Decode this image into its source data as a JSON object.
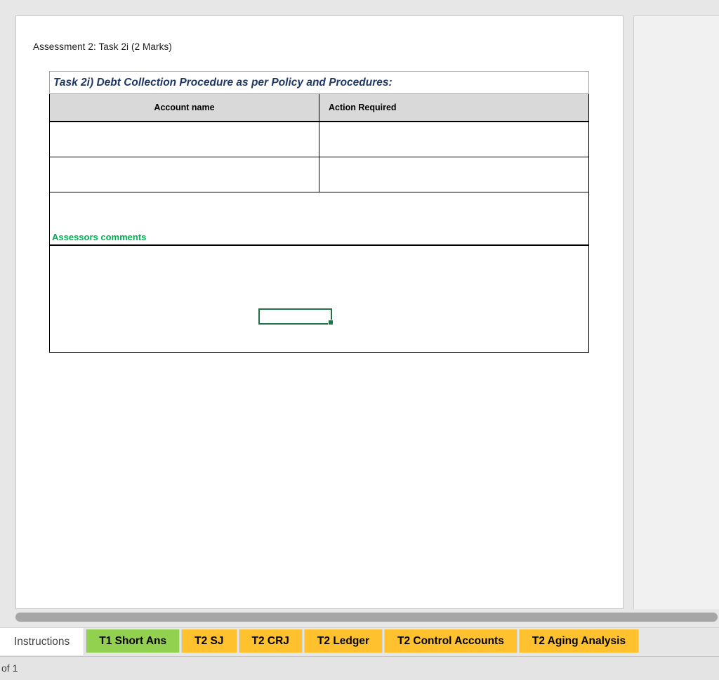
{
  "document": {
    "assessment_caption": "Assessment 2: Task 2i (2 Marks)",
    "table": {
      "title": "Task 2i) Debt Collection Procedure as per Policy and Procedures:",
      "columns": [
        "Account name",
        "Action Required"
      ],
      "rows": [
        {
          "account_name": "",
          "action_required": ""
        },
        {
          "account_name": "",
          "action_required": ""
        }
      ],
      "assessors_comments_label": "Assessors comments",
      "assessors_comments_value": ""
    }
  },
  "selection": {
    "active_cell_value": ""
  },
  "sheet_tabs": [
    {
      "label": "Instructions",
      "state": "active",
      "color": "#ffffff"
    },
    {
      "label": "T1 Short Ans",
      "state": "inactive",
      "color": "#92d050"
    },
    {
      "label": "T2 SJ",
      "state": "inactive",
      "color": "#ffc22e"
    },
    {
      "label": "T2 CRJ",
      "state": "inactive",
      "color": "#ffc22e"
    },
    {
      "label": "T2 Ledger",
      "state": "inactive",
      "color": "#ffc22e"
    },
    {
      "label": "T2 Control Accounts",
      "state": "inactive",
      "color": "#ffc22e"
    },
    {
      "label": "T2 Aging Analysis",
      "state": "inactive",
      "color": "#ffc22e"
    }
  ],
  "status_bar": {
    "page_indicator": "of 1"
  },
  "colors": {
    "title_text": "#1f3864",
    "header_fill": "#d9d9d9",
    "comments_green": "#00b050",
    "selection_green": "#217346",
    "tab_green": "#92d050",
    "tab_orange": "#ffc22e",
    "scrollbar_thumb": "#a6a6a6"
  }
}
